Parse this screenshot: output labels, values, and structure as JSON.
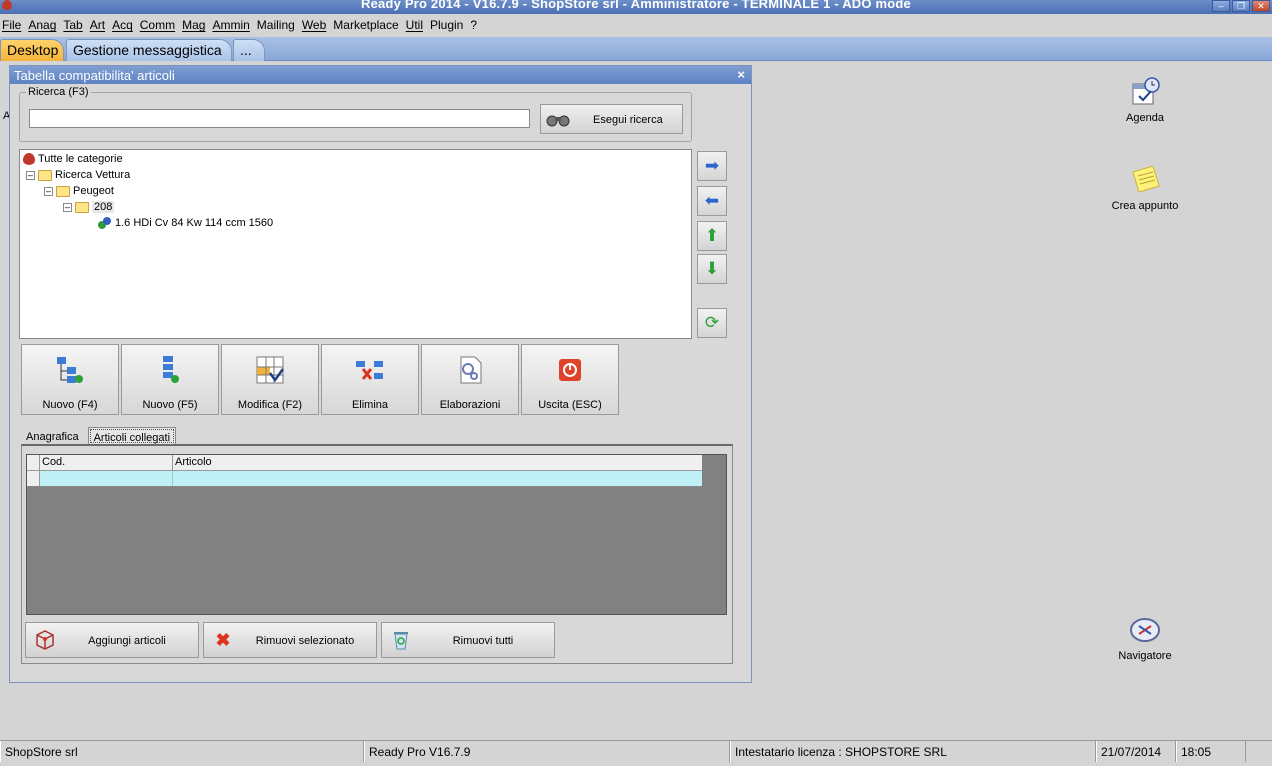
{
  "window": {
    "title": "Ready Pro 2014 - V16.7.9 - ShopStore srl - Amministratore - TERMINALE 1 - ADO mode"
  },
  "menu": [
    "File",
    "Anag",
    "Tab",
    "Art",
    "Acq",
    "Comm",
    "Mag",
    "Ammin",
    "Mailing",
    "Web",
    "Marketplace",
    "Util",
    "Plugin",
    "?"
  ],
  "tabs": {
    "desktop": "Desktop",
    "messaging": "Gestione messaggistica",
    "more": "..."
  },
  "dialog": {
    "title": "Tabella compatibilita' articoli",
    "close": "×",
    "search": {
      "label": "Ricerca (F3)",
      "value": "",
      "button": "Esegui ricerca"
    },
    "tree": {
      "root": "Tutte le categorie",
      "level1": "Ricerca Vettura",
      "level2": "Peugeot",
      "level3": "208",
      "leaf": "1.6 HDi Cv 84 Kw 114 ccm 1560"
    },
    "buttons": {
      "new_f4": "Nuovo (F4)",
      "new_f5": "Nuovo (F5)",
      "edit": "Modifica (F2)",
      "delete": "Elimina",
      "process": "Elaborazioni",
      "exit": "Uscita (ESC)"
    },
    "subtabs": {
      "registry": "Anagrafica",
      "linked": "Articoli collegati"
    },
    "grid": {
      "columns": [
        "Cod.",
        "Articolo"
      ]
    },
    "actions": {
      "add": "Aggiungi articoli",
      "remove_sel": "Rimuovi selezionato",
      "remove_all": "Rimuovi tutti"
    }
  },
  "desktop": {
    "agenda": "Agenda",
    "note": "Crea appunto",
    "navigator": "Navigatore",
    "side_letter": "A"
  },
  "status": {
    "company": "ShopStore srl",
    "version": "Ready Pro V16.7.9",
    "license": "Intestatario licenza : SHOPSTORE SRL",
    "date": "21/07/2014",
    "time": "18:05"
  }
}
